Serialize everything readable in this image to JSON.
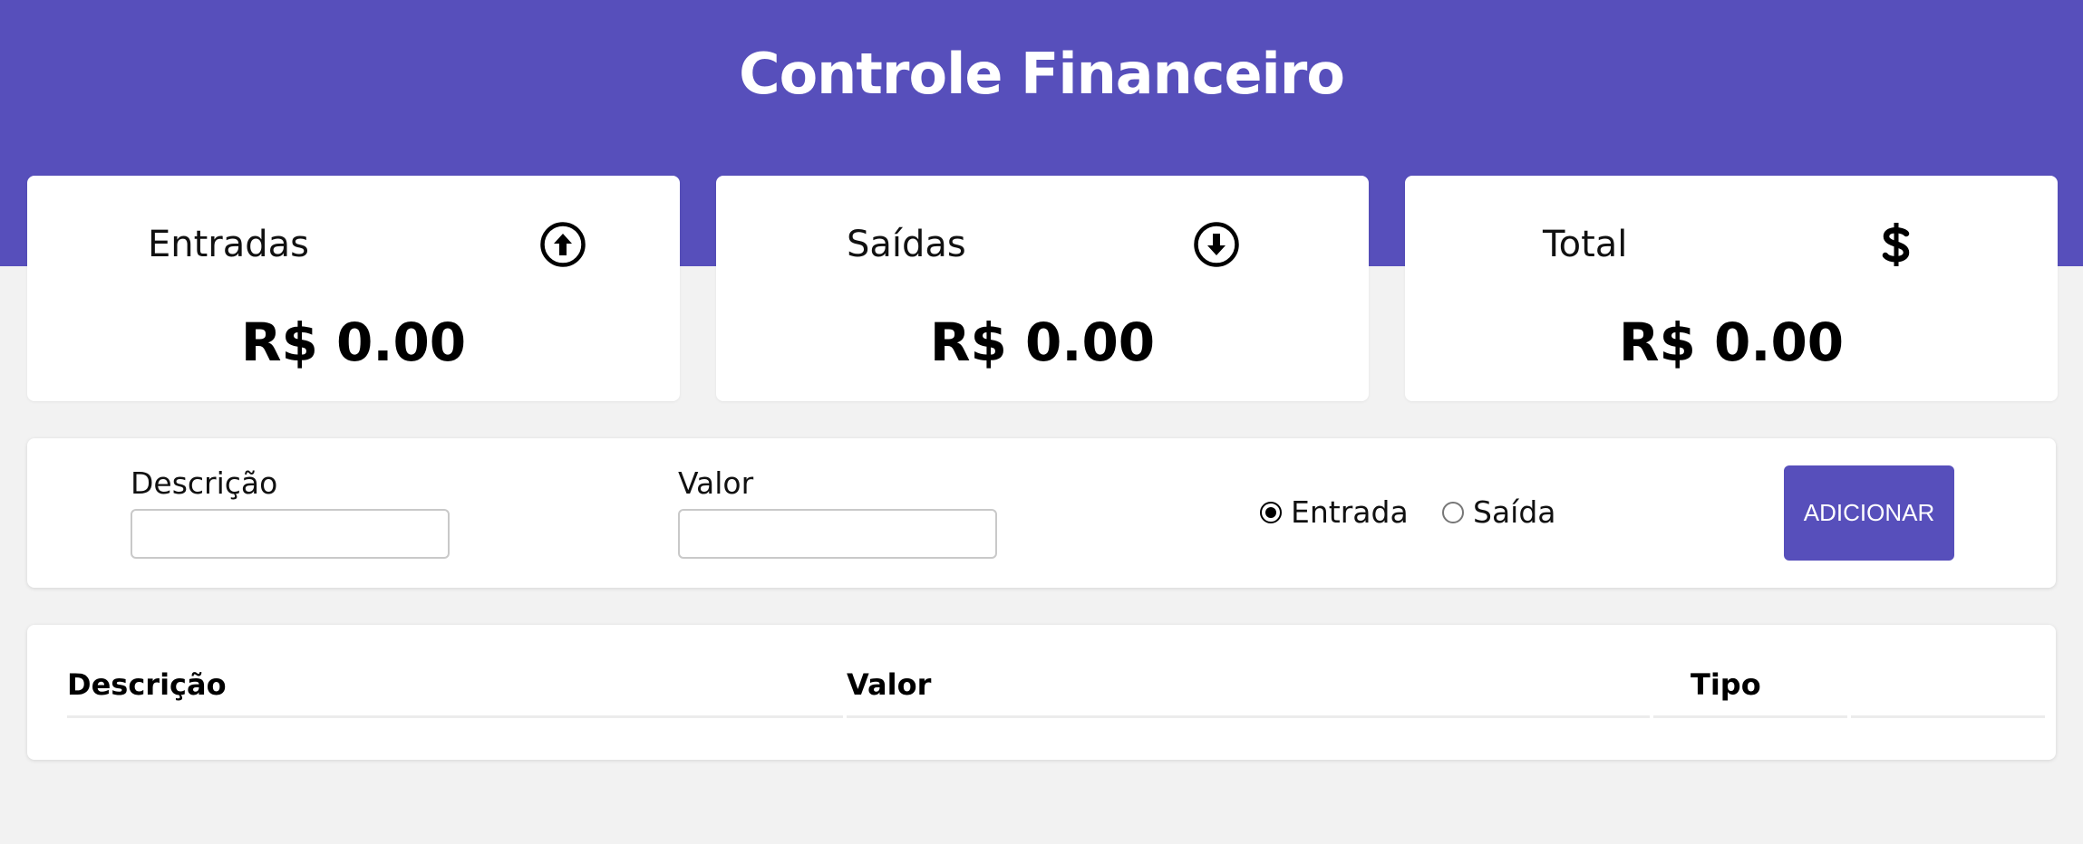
{
  "header": {
    "title": "Controle Financeiro"
  },
  "cards": {
    "income": {
      "label": "Entradas",
      "value": "R$ 0.00",
      "icon": "arrow-up-circle-icon"
    },
    "outcome": {
      "label": "Saídas",
      "value": "R$ 0.00",
      "icon": "arrow-down-circle-icon"
    },
    "total": {
      "label": "Total",
      "value": "R$ 0.00",
      "icon": "dollar-icon"
    }
  },
  "form": {
    "description_label": "Descrição",
    "description_value": "",
    "amount_label": "Valor",
    "amount_value": "",
    "type_options": [
      {
        "label": "Entrada",
        "selected": true
      },
      {
        "label": "Saída",
        "selected": false
      }
    ],
    "submit_label": "ADICIONAR"
  },
  "table": {
    "columns": [
      "Descrição",
      "Valor",
      "Tipo",
      ""
    ],
    "rows": []
  },
  "colors": {
    "brand": "#574fbb",
    "background": "#f2f2f2",
    "card": "#ffffff"
  }
}
